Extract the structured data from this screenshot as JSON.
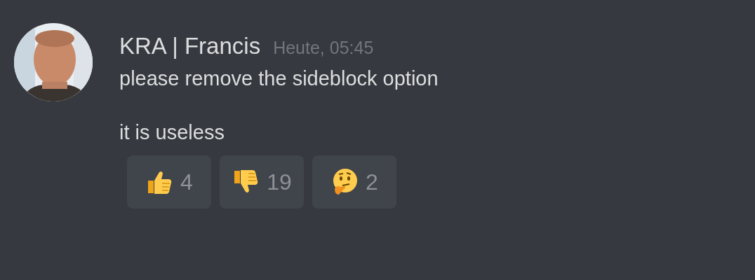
{
  "message": {
    "author": "KRA | Francis",
    "timestamp": "Heute, 05:45",
    "paragraphs": [
      "please remove the sideblock option",
      "it is useless"
    ],
    "reactions": [
      {
        "kind": "thumbs_up",
        "count": "4"
      },
      {
        "kind": "thumbs_down",
        "count": "19"
      },
      {
        "kind": "thinking",
        "count": "2"
      }
    ]
  }
}
